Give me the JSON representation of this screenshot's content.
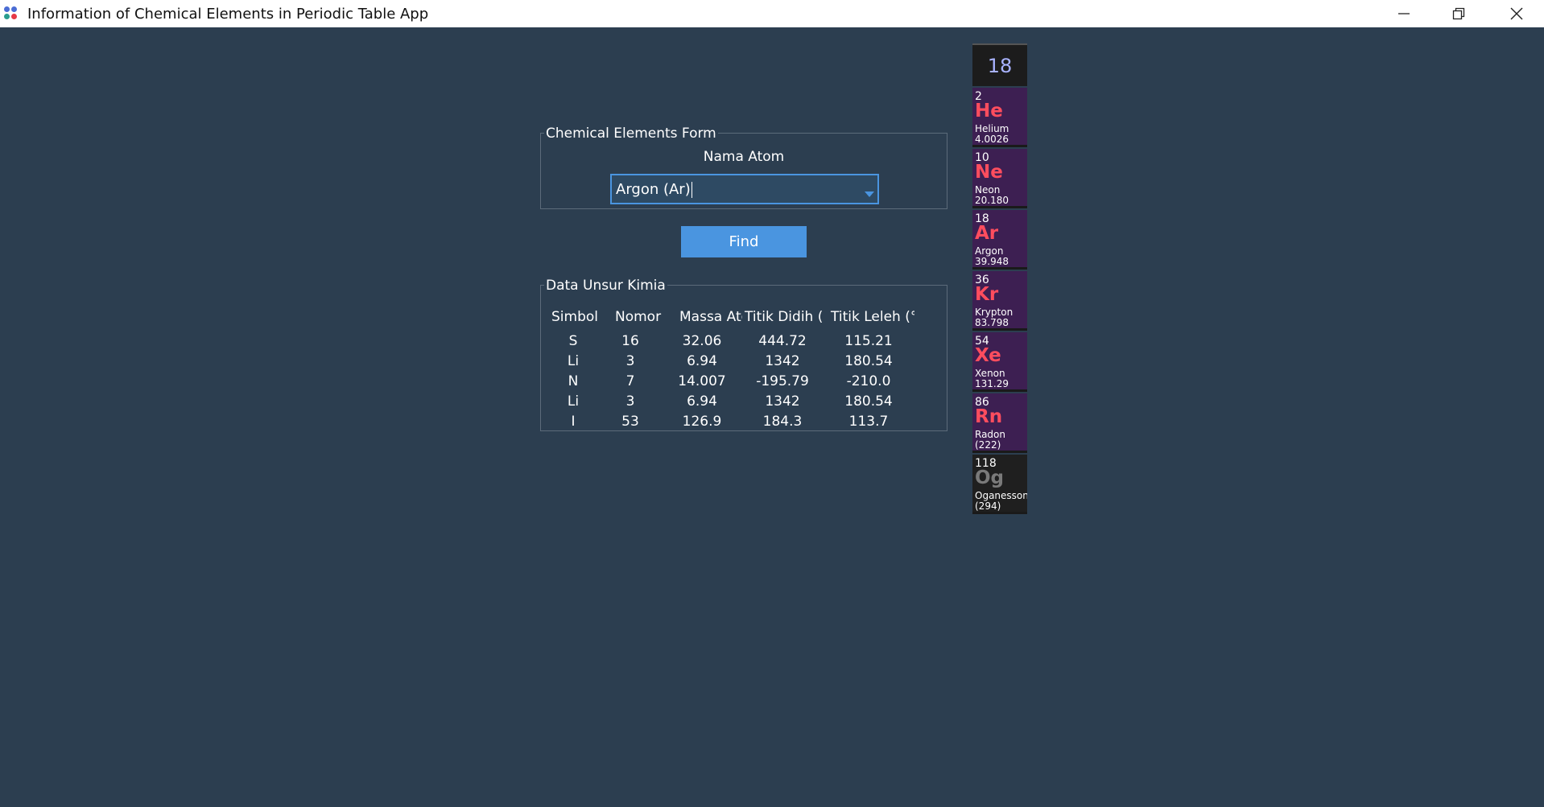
{
  "window": {
    "title": "Information of Chemical Elements in Periodic Table App",
    "icon_dot_colors": [
      "#4a6cd4",
      "#e63946",
      "#2a9d8f",
      "#e76f51"
    ]
  },
  "form": {
    "group_title": "Chemical Elements Form",
    "label": "Nama Atom",
    "selected_value": "Argon (Ar)",
    "find_label": "Find"
  },
  "table": {
    "group_title": "Data Unsur Kimia",
    "columns": [
      "Simbol",
      "Nomor Atom",
      "Massa Atom",
      "Titik Didih (°C)",
      "Titik Leleh (°C)"
    ],
    "columns_visible": [
      "Simbol",
      "Nomor /",
      "Massa Ato",
      "Titik Didih (°C",
      "Titik Leleh (°C"
    ],
    "rows": [
      [
        "S",
        "16",
        "32.06",
        "444.72",
        "115.21"
      ],
      [
        "Li",
        "3",
        "6.94",
        "1342",
        "180.54"
      ],
      [
        "N",
        "7",
        "14.007",
        "-195.79",
        "-210.0"
      ],
      [
        "Li",
        "3",
        "6.94",
        "1342",
        "180.54"
      ],
      [
        "I",
        "53",
        "126.9",
        "184.3",
        "113.7"
      ]
    ]
  },
  "periodic_group": {
    "number": "18",
    "elements": [
      {
        "number": "2",
        "symbol": "He",
        "name": "Helium",
        "mass": "4.0026"
      },
      {
        "number": "10",
        "symbol": "Ne",
        "name": "Neon",
        "mass": "20.180"
      },
      {
        "number": "18",
        "symbol": "Ar",
        "name": "Argon",
        "mass": "39.948"
      },
      {
        "number": "36",
        "symbol": "Kr",
        "name": "Krypton",
        "mass": "83.798"
      },
      {
        "number": "54",
        "symbol": "Xe",
        "name": "Xenon",
        "mass": "131.29"
      },
      {
        "number": "86",
        "symbol": "Rn",
        "name": "Radon",
        "mass": "(222)"
      },
      {
        "number": "118",
        "symbol": "Og",
        "name": "Oganesson",
        "mass": "(294)"
      }
    ]
  },
  "colors": {
    "background": "#2c3e50",
    "accent": "#4a95e0",
    "element_bg": "#3d1f52",
    "symbol": "#ff4d5e"
  }
}
